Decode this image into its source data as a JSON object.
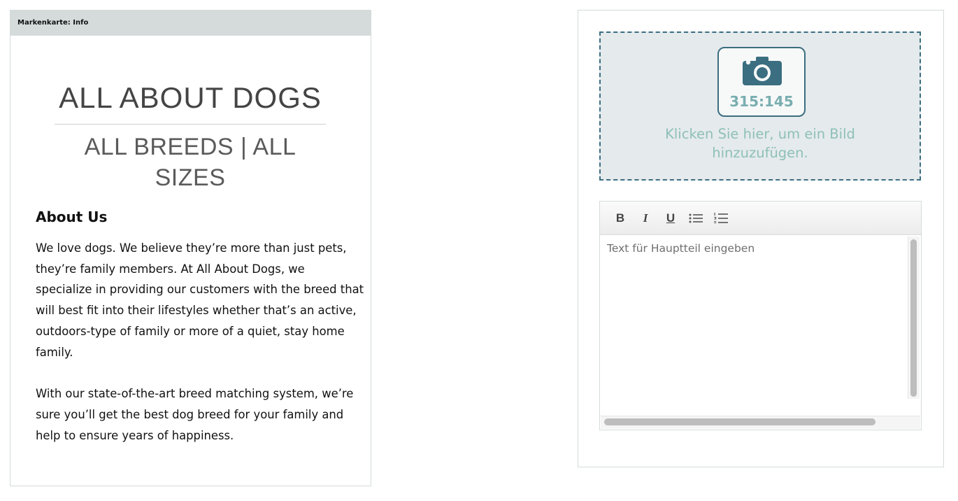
{
  "left_card": {
    "header": "Markenkarte: Info",
    "logo": {
      "title": "ALL ABOUT DOGS",
      "subtitle": "ALL BREEDS | ALL SIZES"
    },
    "heading": "About Us",
    "paragraphs": [
      "We love dogs. We believe they’re more than just pets, they’re family members. At All About Dogs, we specialize in providing our customers with the breed that will best fit into their lifestyles whether that’s an active, outdoors-type of family or more of a quiet, stay home family.",
      "With our state-of-the-art breed matching system, we’re sure you’ll get the best dog breed for your family and help to ensure years of happiness."
    ]
  },
  "right_card": {
    "image_upload": {
      "icon": "camera-icon",
      "ratio": "315:145",
      "label": "Klicken Sie hier, um ein Bild hinzuzufügen."
    },
    "editor": {
      "toolbar": {
        "bold": "B",
        "italic": "I",
        "underline": "U"
      },
      "placeholder": "Text für Hauptteil eingeben"
    }
  },
  "colors": {
    "accent": "#3b6e80",
    "label": "#8ec0b8",
    "header_bg": "#d5dbdb",
    "drop_bg": "#e5eaec"
  }
}
